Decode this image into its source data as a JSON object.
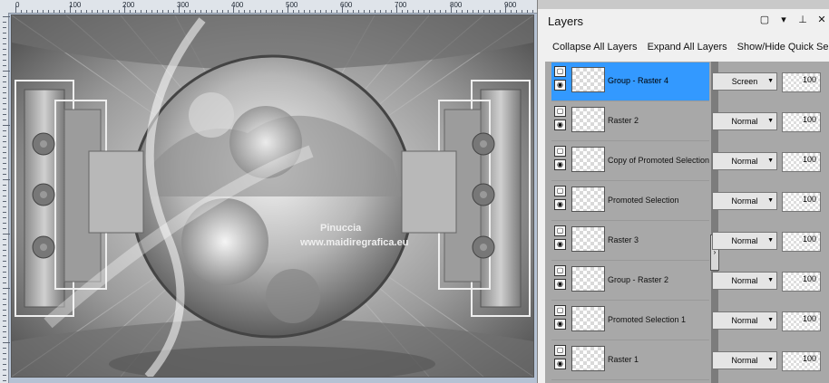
{
  "ruler": {
    "top_labels": [
      "0",
      "100",
      "200",
      "300",
      "400",
      "500",
      "600",
      "700",
      "800",
      "900"
    ],
    "left_labels": [
      "0",
      "100",
      "200",
      "300",
      "400",
      "500",
      "600"
    ]
  },
  "canvas": {
    "watermark_line1": "Pinuccia",
    "watermark_line2": "www.maidiregrafica.eu"
  },
  "palette": {
    "title": "Layers",
    "icons": [
      "restore-icon",
      "chevron-down-icon",
      "pin-icon",
      "close-icon"
    ],
    "toolbar": {
      "collapse_all": "Collapse All Layers",
      "expand_all": "Expand All Layers",
      "show_hide_quick": "Show/Hide Quick Se"
    },
    "layers": [
      {
        "name": "Group - Raster 4",
        "blend": "Screen",
        "opacity": "100",
        "selected": true
      },
      {
        "name": "Raster 2",
        "blend": "Normal",
        "opacity": "100",
        "selected": false
      },
      {
        "name": "Copy of Promoted Selection",
        "blend": "Normal",
        "opacity": "100",
        "selected": false
      },
      {
        "name": "Promoted Selection",
        "blend": "Normal",
        "opacity": "100",
        "selected": false
      },
      {
        "name": "Raster 3",
        "blend": "Normal",
        "opacity": "100",
        "selected": false
      },
      {
        "name": "Group - Raster 2",
        "blend": "Normal",
        "opacity": "100",
        "selected": false
      },
      {
        "name": "Promoted Selection 1",
        "blend": "Normal",
        "opacity": "100",
        "selected": false
      },
      {
        "name": "Raster 1",
        "blend": "Normal",
        "opacity": "100",
        "selected": false
      }
    ]
  },
  "colors": {
    "selection": "#3399ff",
    "canvas_bg": "#b5c2d4"
  }
}
